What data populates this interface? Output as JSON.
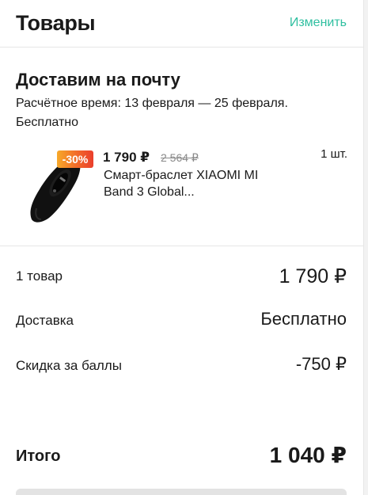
{
  "header": {
    "title": "Товары",
    "edit_label": "Изменить",
    "accent_color": "#2fbfa0"
  },
  "delivery": {
    "title": "Доставим на почту",
    "eta": "Расчётное время: 13 февраля — 25 февраля. Бесплатно"
  },
  "product": {
    "discount": "-30%",
    "price_now": "1 790 ₽",
    "price_old": "2 564 ₽",
    "name": "Смарт-браслет XIAOMI MI Band 3 Global...",
    "quantity": "1 шт.",
    "image_icon": "fitness-band-icon"
  },
  "summary": {
    "items_label": "1 товар",
    "items_value": "1 790 ₽",
    "shipping_label": "Доставка",
    "shipping_value": "Бесплатно",
    "points_label": "Скидка за баллы",
    "points_value": "-750 ₽"
  },
  "total": {
    "label": "Итого",
    "value": "1 040 ₽"
  }
}
